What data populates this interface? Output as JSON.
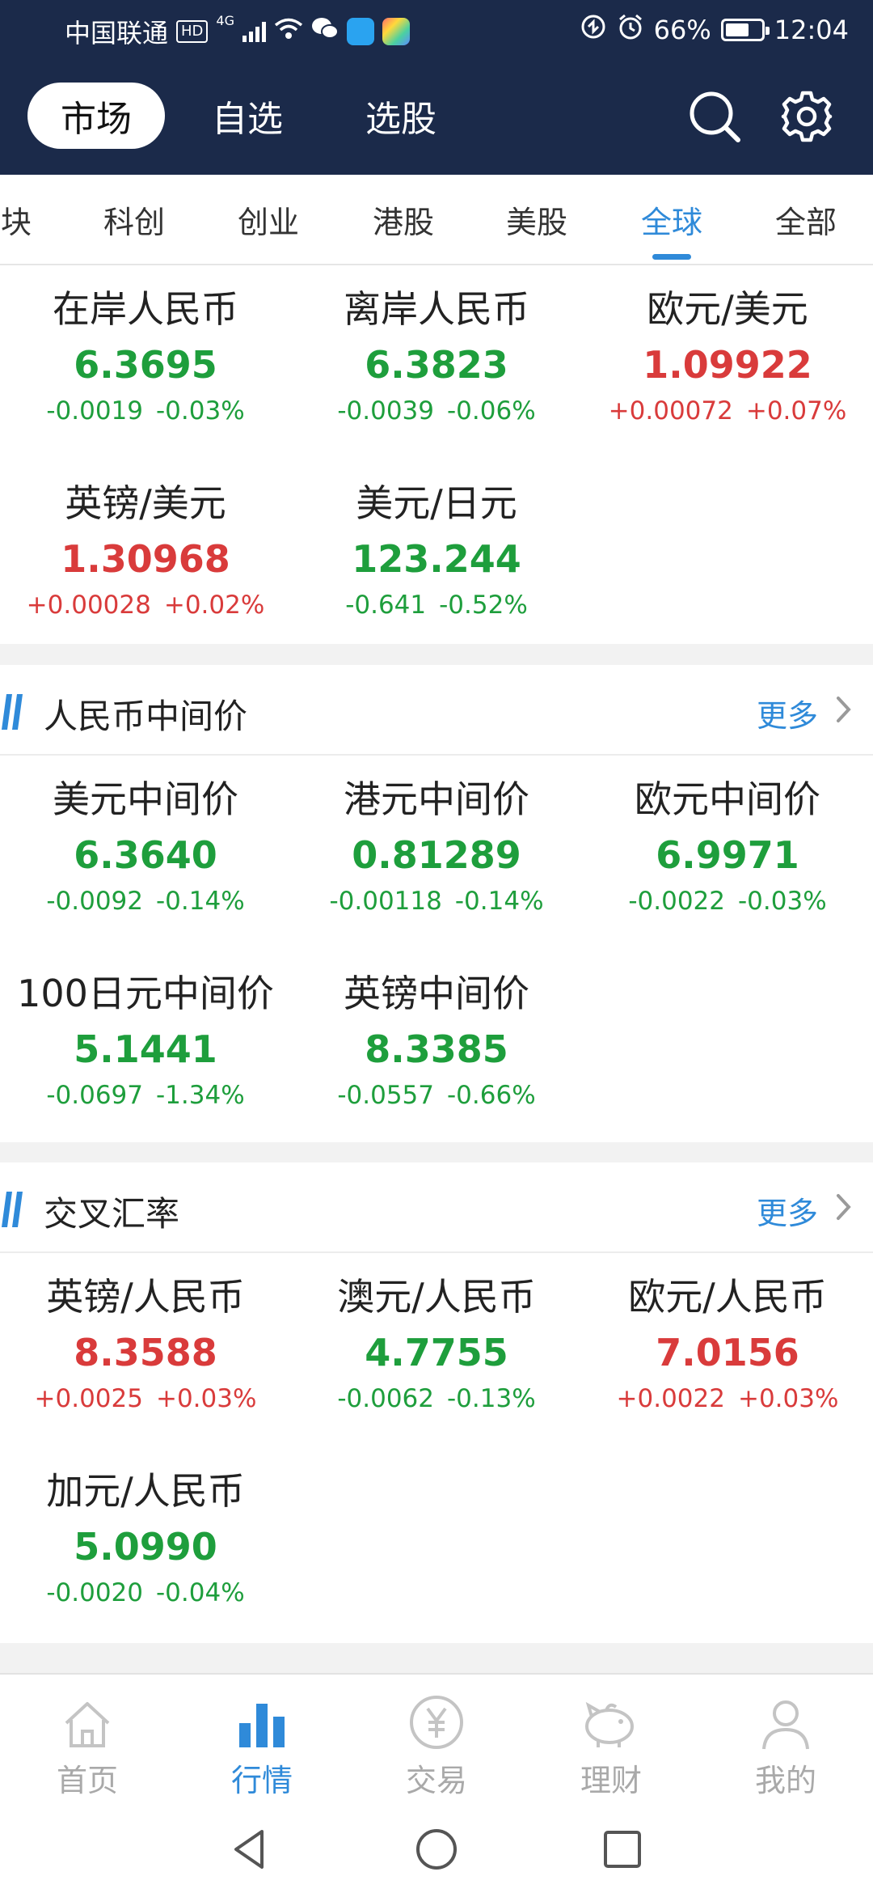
{
  "status_bar": {
    "carrier": "中国联通",
    "hd": "HD",
    "network": "4G",
    "battery": "66%",
    "battery_level": 0.66,
    "time": "12:04"
  },
  "header": {
    "tabs": [
      {
        "label": "市场",
        "active": true
      },
      {
        "label": "自选",
        "active": false
      },
      {
        "label": "选股",
        "active": false
      }
    ],
    "icons": [
      "search-icon",
      "gear-icon"
    ]
  },
  "subtabs": {
    "items": [
      {
        "label": "块",
        "active": false
      },
      {
        "label": "科创",
        "active": false
      },
      {
        "label": "创业",
        "active": false
      },
      {
        "label": "港股",
        "active": false
      },
      {
        "label": "美股",
        "active": false
      },
      {
        "label": "全球",
        "active": true
      },
      {
        "label": "全部",
        "active": false
      }
    ]
  },
  "colors": {
    "header_bg": "#1b2a4a",
    "accent": "#2f8ad9",
    "up": "#d93b3b",
    "down": "#1e9e3c"
  },
  "sections": [
    {
      "title": "",
      "more": "",
      "quotes": [
        {
          "name": "在岸人民币",
          "price": "6.3695",
          "change": "-0.0019",
          "pct": "-0.03%",
          "dir": "down"
        },
        {
          "name": "离岸人民币",
          "price": "6.3823",
          "change": "-0.0039",
          "pct": "-0.06%",
          "dir": "down"
        },
        {
          "name": "欧元/美元",
          "price": "1.09922",
          "change": "+0.00072",
          "pct": "+0.07%",
          "dir": "up"
        },
        {
          "name": "英镑/美元",
          "price": "1.30968",
          "change": "+0.00028",
          "pct": "+0.02%",
          "dir": "up"
        },
        {
          "name": "美元/日元",
          "price": "123.244",
          "change": "-0.641",
          "pct": "-0.52%",
          "dir": "down"
        }
      ]
    },
    {
      "title": "人民币中间价",
      "more": "更多",
      "quotes": [
        {
          "name": "美元中间价",
          "price": "6.3640",
          "change": "-0.0092",
          "pct": "-0.14%",
          "dir": "down"
        },
        {
          "name": "港元中间价",
          "price": "0.81289",
          "change": "-0.00118",
          "pct": "-0.14%",
          "dir": "down"
        },
        {
          "name": "欧元中间价",
          "price": "6.9971",
          "change": "-0.0022",
          "pct": "-0.03%",
          "dir": "down"
        },
        {
          "name": "100日元中间价",
          "price": "5.1441",
          "change": "-0.0697",
          "pct": "-1.34%",
          "dir": "down"
        },
        {
          "name": "英镑中间价",
          "price": "8.3385",
          "change": "-0.0557",
          "pct": "-0.66%",
          "dir": "down"
        }
      ]
    },
    {
      "title": "交叉汇率",
      "more": "更多",
      "quotes": [
        {
          "name": "英镑/人民币",
          "price": "8.3588",
          "change": "+0.0025",
          "pct": "+0.03%",
          "dir": "up"
        },
        {
          "name": "澳元/人民币",
          "price": "4.7755",
          "change": "-0.0062",
          "pct": "-0.13%",
          "dir": "down"
        },
        {
          "name": "欧元/人民币",
          "price": "7.0156",
          "change": "+0.0022",
          "pct": "+0.03%",
          "dir": "up"
        },
        {
          "name": "加元/人民币",
          "price": "5.0990",
          "change": "-0.0020",
          "pct": "-0.04%",
          "dir": "down"
        }
      ]
    }
  ],
  "bottom_nav": {
    "items": [
      {
        "label": "首页",
        "icon": "home-icon",
        "active": false
      },
      {
        "label": "行情",
        "icon": "market-chart-icon",
        "active": true
      },
      {
        "label": "交易",
        "icon": "yuan-coin-icon",
        "active": false
      },
      {
        "label": "理财",
        "icon": "piggy-bank-icon",
        "active": false
      },
      {
        "label": "我的",
        "icon": "user-icon",
        "active": false
      }
    ]
  },
  "system_nav": [
    "back-icon",
    "home-circle-icon",
    "recents-icon"
  ]
}
